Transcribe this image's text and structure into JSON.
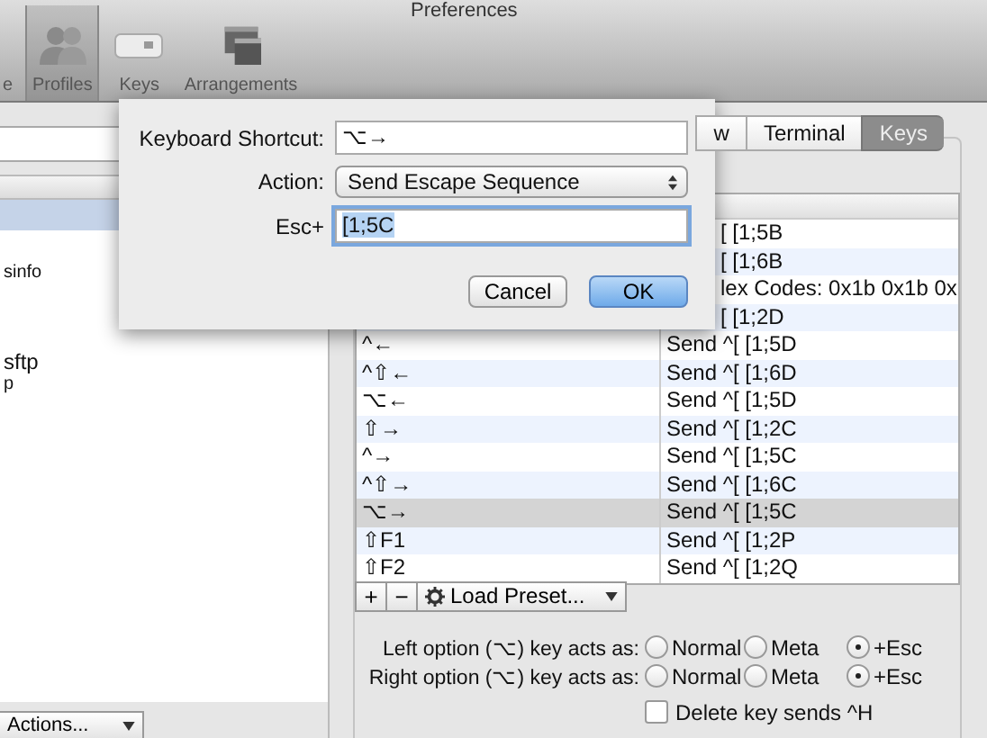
{
  "window": {
    "title": "Preferences"
  },
  "toolbar": [
    {
      "label": "e",
      "kind": "general",
      "selected": false
    },
    {
      "label": "Profiles",
      "kind": "profiles",
      "selected": true
    },
    {
      "label": "Keys",
      "kind": "keys",
      "selected": false
    },
    {
      "label": "Arrangements",
      "kind": "arrangements",
      "selected": false
    }
  ],
  "profiles": {
    "rows": [
      {
        "selected": true
      },
      {
        "selected": false,
        "name": "sinfo",
        "kind": "small"
      },
      {
        "selected": false,
        "name": "sftp",
        "kind": "large",
        "subtitle": "p"
      }
    ],
    "actions_button": "Actions..."
  },
  "tabs": [
    {
      "label": "w",
      "selected": false
    },
    {
      "label": "Terminal",
      "selected": false
    },
    {
      "label": "Keys",
      "selected": true
    }
  ],
  "key_table": {
    "rows": [
      {
        "kind": "covered",
        "action": "[ [1;5B",
        "selected": false
      },
      {
        "kind": "covered",
        "action": "[ [1;6B",
        "selected": false
      },
      {
        "kind": "covered",
        "action": "lex Codes: 0x1b 0x1b 0x",
        "selected": false
      },
      {
        "kind": "covered",
        "action": "[ [1;2D",
        "selected": false
      },
      {
        "kind": "full",
        "shortcut": "^←",
        "action": "Send ^[ [1;5D",
        "selected": false
      },
      {
        "kind": "full",
        "shortcut": "^⇧←",
        "action": "Send ^[ [1;6D",
        "selected": false
      },
      {
        "kind": "full",
        "shortcut": "⌥←",
        "action": "Send ^[ [1;5D",
        "selected": false
      },
      {
        "kind": "full",
        "shortcut": "⇧→",
        "action": "Send ^[ [1;2C",
        "selected": false
      },
      {
        "kind": "full",
        "shortcut": "^→",
        "action": "Send ^[ [1;5C",
        "selected": false
      },
      {
        "kind": "full",
        "shortcut": "^⇧→",
        "action": "Send ^[ [1;6C",
        "selected": false
      },
      {
        "kind": "full",
        "shortcut": "⌥→",
        "action": "Send ^[ [1;5C",
        "selected": true
      },
      {
        "kind": "full",
        "shortcut": "⇧F1",
        "action": "Send ^[ [1;2P",
        "selected": false
      },
      {
        "kind": "full",
        "shortcut": "⇧F2",
        "action": "Send ^[ [1;2Q",
        "selected": false
      }
    ],
    "add_button": "+",
    "remove_button": "−",
    "load_preset": "Load Preset..."
  },
  "option_keys": [
    {
      "label": "Left option (⌥) key acts as:",
      "options": [
        {
          "label": "Normal",
          "selected": false
        },
        {
          "label": "Meta",
          "selected": false
        },
        {
          "label": "+Esc",
          "selected": true
        }
      ]
    },
    {
      "label": "Right option (⌥) key acts as:",
      "options": [
        {
          "label": "Normal",
          "selected": false
        },
        {
          "label": "Meta",
          "selected": false
        },
        {
          "label": "+Esc",
          "selected": true
        }
      ]
    }
  ],
  "delete_key": {
    "label": "Delete key sends ^H",
    "checked": false
  },
  "dialog": {
    "shortcut_label": "Keyboard Shortcut:",
    "shortcut_value": "⌥→",
    "action_label": "Action:",
    "action_value": "Send Escape Sequence",
    "esc_label": "Esc+",
    "esc_value": "[1;5C",
    "buttons": [
      {
        "label": "Cancel",
        "kind": "normal"
      },
      {
        "label": "OK",
        "kind": "default"
      }
    ]
  }
}
